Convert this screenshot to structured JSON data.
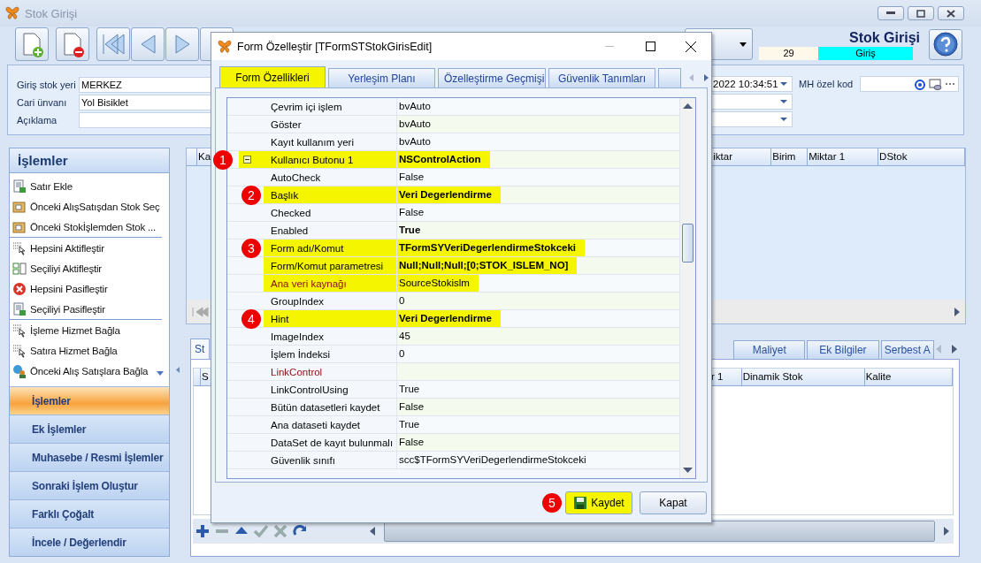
{
  "window": {
    "title": "Stok Girişi"
  },
  "header": {
    "title": "Stok Girişi",
    "number": "29",
    "type": "Giriş"
  },
  "form": {
    "fields": [
      {
        "label": "Giriş stok yeri",
        "value": "MERKEZ"
      },
      {
        "label": "Cari ünvanı",
        "value": "Yol Bisiklet"
      },
      {
        "label": "Açıklama"
      }
    ],
    "date": {
      "value": "2022 10:34:51"
    },
    "mh_code": {
      "label": "MH özel kod"
    }
  },
  "sidebar": {
    "title": "İşlemler",
    "groups": [
      {
        "items": [
          {
            "label": "Satır Ekle"
          },
          {
            "label": "Önceki AlışSatışdan Stok Seç"
          },
          {
            "label": "Önceki Stokİşlemden Stok ..."
          }
        ]
      },
      {
        "items": [
          {
            "label": "Hepsini Aktifleştir"
          },
          {
            "label": "Seçiliyi Aktifleştir"
          },
          {
            "label": "Hepsini Pasifleştir"
          },
          {
            "label": "Seçiliyi Pasifleştir"
          }
        ]
      },
      {
        "items": [
          {
            "label": "İşleme Hizmet Bağla"
          },
          {
            "label": "Satıra Hizmet Bağla"
          },
          {
            "label": "Önceki Alış Satışlara Bağla"
          }
        ]
      }
    ],
    "nav": [
      {
        "label": "İşlemler",
        "selected": true
      },
      {
        "label": "Ek İşlemler",
        "selected": false
      },
      {
        "label": "Muhasebe / Resmi İşlemler",
        "selected": false
      },
      {
        "label": "Sonraki İşlem Oluştur",
        "selected": false
      },
      {
        "label": "Farklı Çoğalt",
        "selected": false
      },
      {
        "label": "İncele / Değerlendir",
        "selected": false
      }
    ]
  },
  "upper_grid": {
    "columns": [
      "Ka",
      "iktar",
      "Birim",
      "Miktar 1",
      "DStok"
    ]
  },
  "lower": {
    "tabs": [
      {
        "label": "St",
        "selected": true
      },
      {
        "label": "Maliyet",
        "selected": false
      },
      {
        "label": "Ek Bilgiler",
        "selected": false
      },
      {
        "label": "Serbest A",
        "selected": false
      }
    ],
    "columns": [
      "S",
      "r 1",
      "Dinamik Stok",
      "Kalite"
    ]
  },
  "dialog": {
    "title": "Form Özelleştir [TFormSTStokGirisEdit]",
    "tabs": [
      {
        "label": "Form Özellikleri",
        "selected": true,
        "highlight": true
      },
      {
        "label": "Yerleşim Planı",
        "selected": false,
        "highlight": false
      },
      {
        "label": "Özelleştirme Geçmişi",
        "selected": false,
        "highlight": false
      },
      {
        "label": "Güvenlik Tanımları",
        "selected": false,
        "highlight": false
      }
    ],
    "properties": [
      {
        "name": "Çevrim içi işlem",
        "value": "bvAuto"
      },
      {
        "name": "Göster",
        "value": "bvAuto"
      },
      {
        "name": "Kayıt kullanım yeri",
        "value": "bvAuto"
      },
      {
        "name": "Kullanıcı Butonu 1",
        "value": "NSControlAction",
        "bold": true,
        "highlight": true,
        "marker": "1",
        "expanded": true,
        "children": [
          {
            "name": "AutoCheck",
            "value": "False"
          },
          {
            "name": "Başlık",
            "value": "Veri Degerlendirme",
            "bold": true,
            "highlight": true,
            "marker": "2"
          },
          {
            "name": "Checked",
            "value": "False"
          },
          {
            "name": "Enabled",
            "value": "True",
            "bold": true
          },
          {
            "name": "Form adı/Komut",
            "value": "TFormSYVeriDegerlendirmeStokceki",
            "bold": true,
            "highlight": true,
            "marker": "3"
          },
          {
            "name": "Form/Komut parametresi",
            "value": "Null;Null;Null;[0;STOK_ISLEM_NO]",
            "bold": true,
            "highlight": true
          },
          {
            "name": "Ana veri kaynağı",
            "value": "SourceStokislm",
            "required": true,
            "highlight": true
          },
          {
            "name": "GroupIndex",
            "value": "0"
          },
          {
            "name": "Hint",
            "value": "Veri Degerlendirme",
            "bold": true,
            "highlight": true,
            "marker": "4"
          },
          {
            "name": "ImageIndex",
            "value": "45"
          },
          {
            "name": "İşlem İndeksi",
            "value": "0"
          },
          {
            "name": "LinkControl",
            "required": true
          },
          {
            "name": "LinkControlUsing",
            "value": "True"
          },
          {
            "name": "Bütün datasetleri kaydet",
            "value": "False"
          },
          {
            "name": "Ana dataseti kaydet",
            "value": "True"
          },
          {
            "name": "DataSet de kayıt bulunmalı",
            "value": "False"
          },
          {
            "name": "Güvenlik sınıfı",
            "value": "scc$TFormSYVeriDegerlendirmeStokceki"
          }
        ]
      }
    ],
    "buttons": [
      {
        "label": "Kaydet",
        "kind": "save",
        "highlight": true,
        "marker": "5"
      },
      {
        "label": "Kapat",
        "kind": "close",
        "highlight": false
      }
    ]
  }
}
